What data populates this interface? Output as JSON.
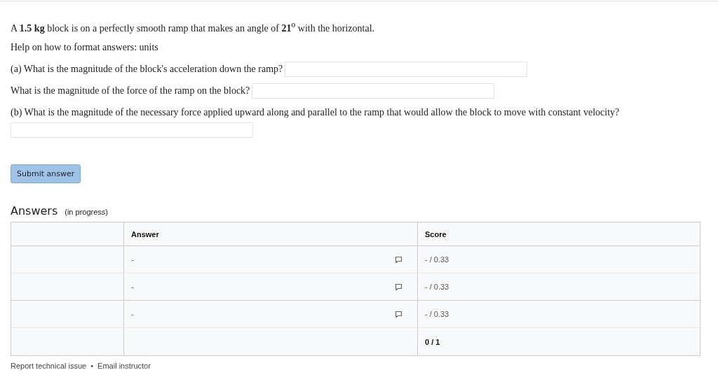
{
  "problem": {
    "statement": "A **1.5 kg** block is on a perfectly smooth ramp that makes an angle of **21**$^{o}$ with the horizontal.",
    "help_text": "Help on how to format answers: ",
    "help_link": "units"
  },
  "questions": [
    {
      "prompt": "(a) What is the magnitude of the block's acceleration down the ramp?",
      "newline": false
    },
    {
      "prompt": "What is the magnitude of the force of the ramp on the block?",
      "newline": false
    },
    {
      "prompt": "(b) What is the magnitude of the necessary force applied upward along and parallel to the ramp that would allow the block to move with constant velocity?",
      "newline": true
    }
  ],
  "submit_button": "Submit answer",
  "answers": {
    "title": "Answers",
    "status": "(in progress)",
    "columns": [
      "Answer",
      "Score"
    ],
    "rows": [
      {
        "kind": "answer",
        "answer": "-",
        "score": "- / 0.33",
        "group_end": false
      },
      {
        "kind": "answer",
        "answer": "-",
        "score": "- / 0.33",
        "group_end": true
      },
      {
        "kind": "answer",
        "answer": "-",
        "score": "- / 0.33",
        "group_end": false
      },
      {
        "kind": "total",
        "score": "0 / 1"
      }
    ]
  },
  "footer": {
    "links": [
      "Report technical issue",
      "Email instructor"
    ],
    "separator": "•"
  }
}
